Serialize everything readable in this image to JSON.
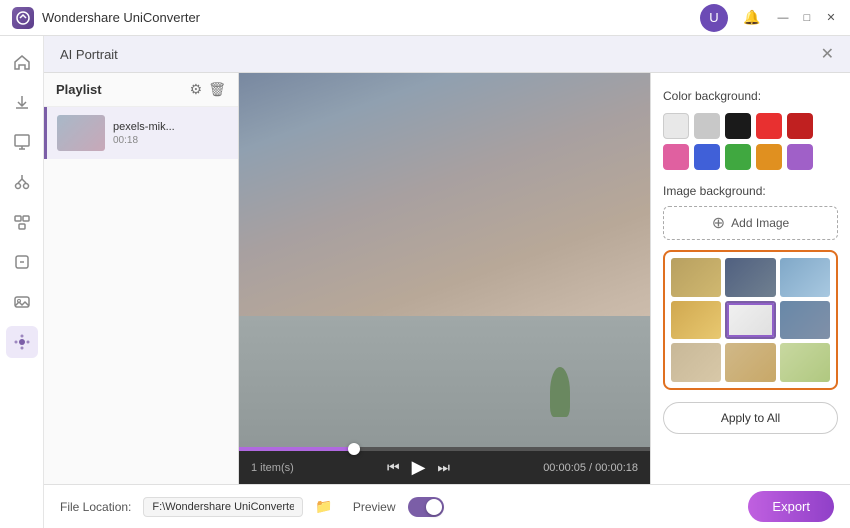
{
  "titleBar": {
    "appName": "Wondershare UniConverter",
    "minBtn": "—",
    "maxBtn": "□",
    "closeBtn": "✕"
  },
  "dialog": {
    "title": "AI Portrait",
    "closeBtn": "✕"
  },
  "playlist": {
    "title": "Playlist",
    "filename": "pexels-mik...",
    "duration": "00:18"
  },
  "videoControls": {
    "itemCount": "1 item(s)",
    "timeDisplay": "00:00:05 / 00:00:18"
  },
  "settings": {
    "colorBgLabel": "Color background:",
    "imageBgLabel": "Image background:",
    "addImageLabel": "Add Image",
    "applyToAll": "Apply to All"
  },
  "bottomBar": {
    "fileLocationLabel": "File Location:",
    "filePath": "F:\\Wondershare UniConverter",
    "previewLabel": "Preview",
    "exportLabel": "Export"
  },
  "sidebar": {
    "icons": [
      "⌂",
      "⬇",
      "↑",
      "✂",
      "⊞",
      "⊡",
      "⊟",
      "⋮⋮"
    ]
  }
}
